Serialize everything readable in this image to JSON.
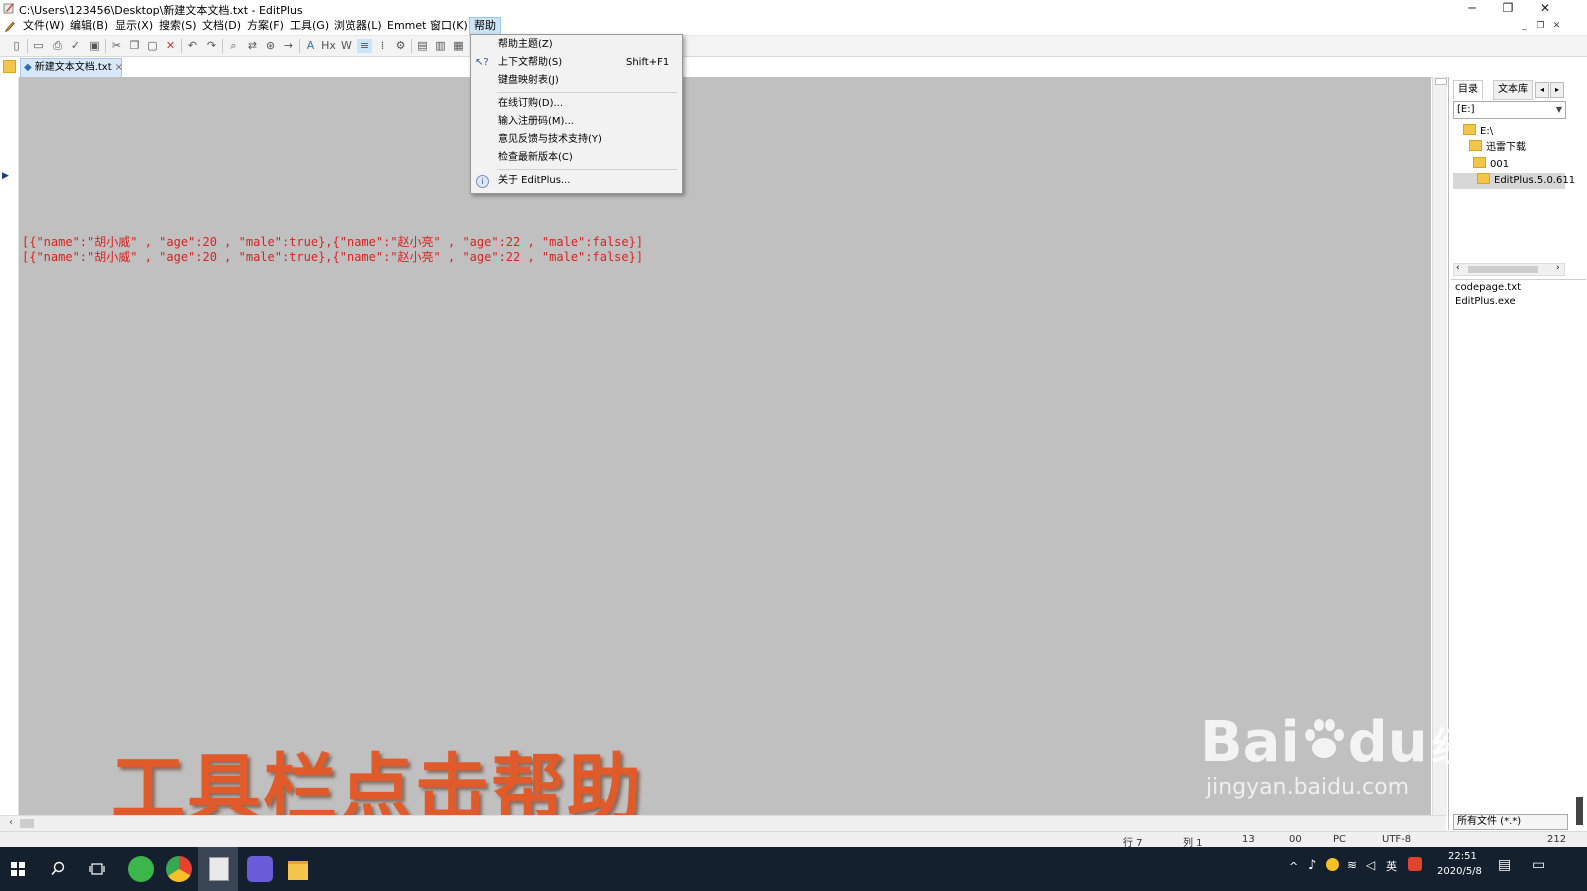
{
  "window": {
    "title": "C:\\Users\\123456\\Desktop\\新建文本文档.txt - EditPlus",
    "controls": {
      "minimize": "─",
      "restore": "❐",
      "close": "✕"
    }
  },
  "menubar": {
    "items": [
      "文件(W)",
      "编辑(B)",
      "显示(X)",
      "搜索(S)",
      "文档(D)",
      "方案(F)",
      "工具(G)",
      "浏览器(L)",
      "Emmet",
      "窗口(K)",
      "帮助"
    ],
    "active": "帮助",
    "mdi_controls": [
      "_",
      "❐",
      "✕"
    ]
  },
  "help_menu": {
    "items": [
      {
        "label": "帮助主题(Z)",
        "shortcut": ""
      },
      {
        "label": "上下文帮助(S)",
        "shortcut": "Shift+F1",
        "icon": "context-help-icon"
      },
      {
        "label": "键盘映射表(J)",
        "shortcut": ""
      },
      {
        "label": "在线订购(D)...",
        "shortcut": ""
      },
      {
        "label": "输入注册码(M)...",
        "shortcut": ""
      },
      {
        "label": "意见反馈与技术支持(Y)",
        "shortcut": ""
      },
      {
        "label": "检查最新版本(C)",
        "shortcut": ""
      },
      {
        "label": "关于 EditPlus...",
        "shortcut": "",
        "icon": "info-icon"
      }
    ]
  },
  "tabs": {
    "document": "新建文本文档.txt"
  },
  "editor": {
    "lines": [
      "[{\"name\":\"胡小威\" , \"age\":20 , \"male\":true},{\"name\":\"赵小亮\" , \"age\":22 , \"male\":false}]",
      "[{\"name\":\"胡小威\" , \"age\":20 , \"male\":true},{\"name\":\"赵小亮\" , \"age\":22 , \"male\":false}]"
    ],
    "text_color": "#d8231f",
    "background": "#c0c0c0"
  },
  "overlay": {
    "caption": "工具栏点击帮助",
    "color": "#e15b2a"
  },
  "side_panel": {
    "tabs": [
      "目录",
      "文本库"
    ],
    "drive": "[E:]",
    "tree": [
      "E:\\",
      "迅雷下载",
      "001",
      "EditPlus.5.0.611"
    ],
    "files": [
      "codepage.txt",
      "EditPlus.exe"
    ],
    "filter": "所有文件 (*.*)"
  },
  "statusbar": {
    "row": "行 7",
    "col": "列 1",
    "n1": "13",
    "n2": "00",
    "mode": "PC",
    "encoding": "UTF-8",
    "size": "212"
  },
  "taskbar": {
    "tray": {
      "ime": "英",
      "time": "22:51",
      "date": "2020/5/8"
    }
  },
  "watermark": {
    "brand": "Bai",
    "brand2": "du",
    "cn": "经验",
    "url": "jingyan.baidu.com"
  }
}
